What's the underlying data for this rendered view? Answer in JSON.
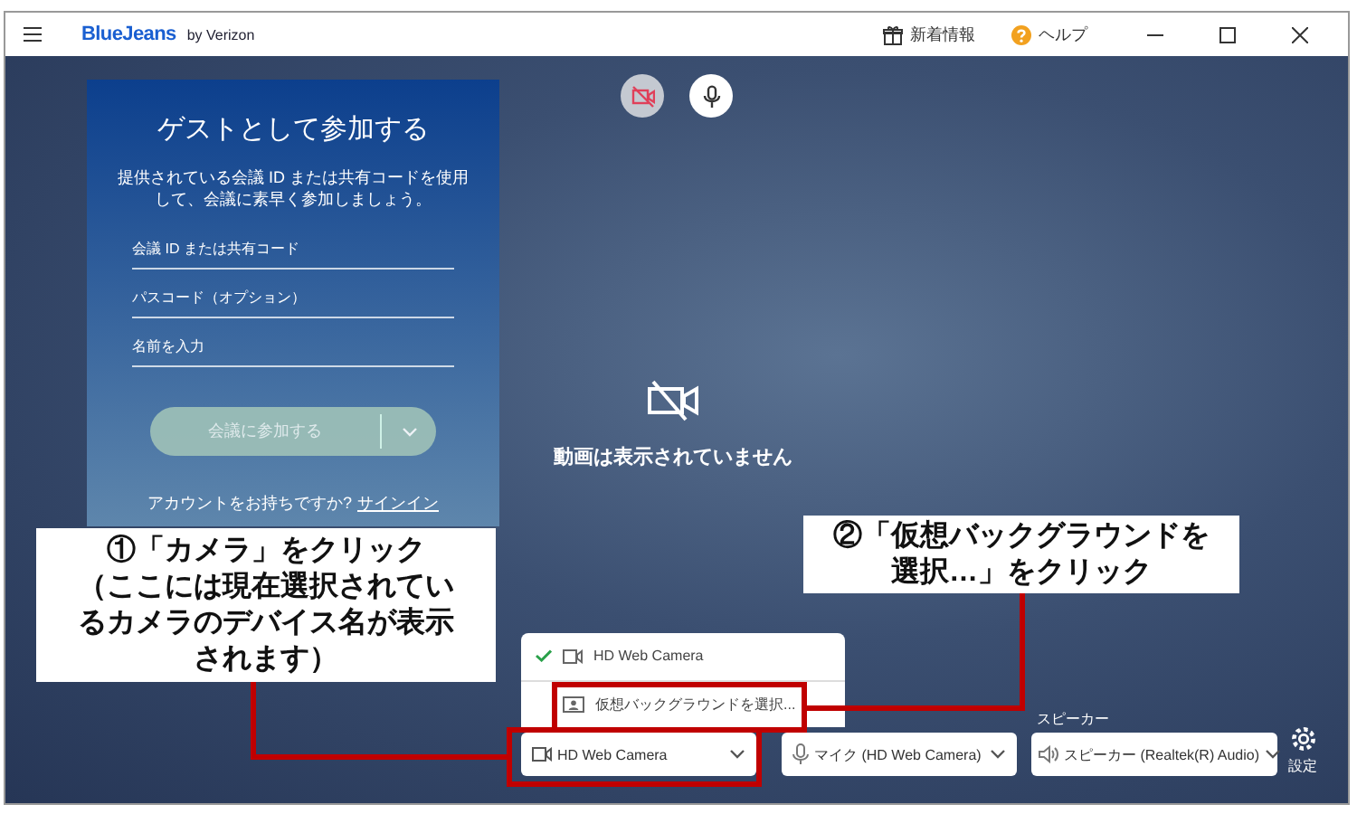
{
  "title_bar": {
    "logo": "BlueJeans",
    "logo_suffix": "by Verizon",
    "links": [
      {
        "kind": "gift",
        "label": "新着情報"
      },
      {
        "kind": "help",
        "label": "ヘルプ"
      }
    ]
  },
  "media_toggles": [
    {
      "kind": "camera",
      "muted": true
    },
    {
      "kind": "microphone",
      "muted": false
    }
  ],
  "guest_panel": {
    "title": "ゲストとして参加する",
    "description": "提供されている会議 ID または共有コードを使用して、会議に素早く参加しましょう。",
    "fields": [
      {
        "placeholder": "会議 ID または共有コード"
      },
      {
        "placeholder": "パスコード（オプション）"
      },
      {
        "placeholder": "名前を入力"
      }
    ],
    "join_button": {
      "label": "会議に参加する",
      "disabled": true
    },
    "account_prompt": "アカウントをお持ちですか?",
    "sign_in_link": "サインイン"
  },
  "video_status": "動画は表示されていません",
  "camera_menu": [
    {
      "kind": "device",
      "label": "HD Web Camera",
      "selected": true
    },
    {
      "kind": "action",
      "label": "仮想バックグラウンドを選択...",
      "selected": false
    }
  ],
  "device_bar": {
    "camera": "HD Web Camera",
    "microphone": "マイク (HD Web Camera)",
    "speaker_label": "スピーカー",
    "speaker": "スピーカー (Realtek(R) Audio)",
    "settings": "設定"
  },
  "callouts": [
    {
      "title": "①「カメラ」をクリック",
      "note": "（ここには現在選択されているカメラのデバイス名が表示されます）"
    },
    {
      "title": "②「仮想バックグラウンドを選択…」をクリック"
    }
  ]
}
